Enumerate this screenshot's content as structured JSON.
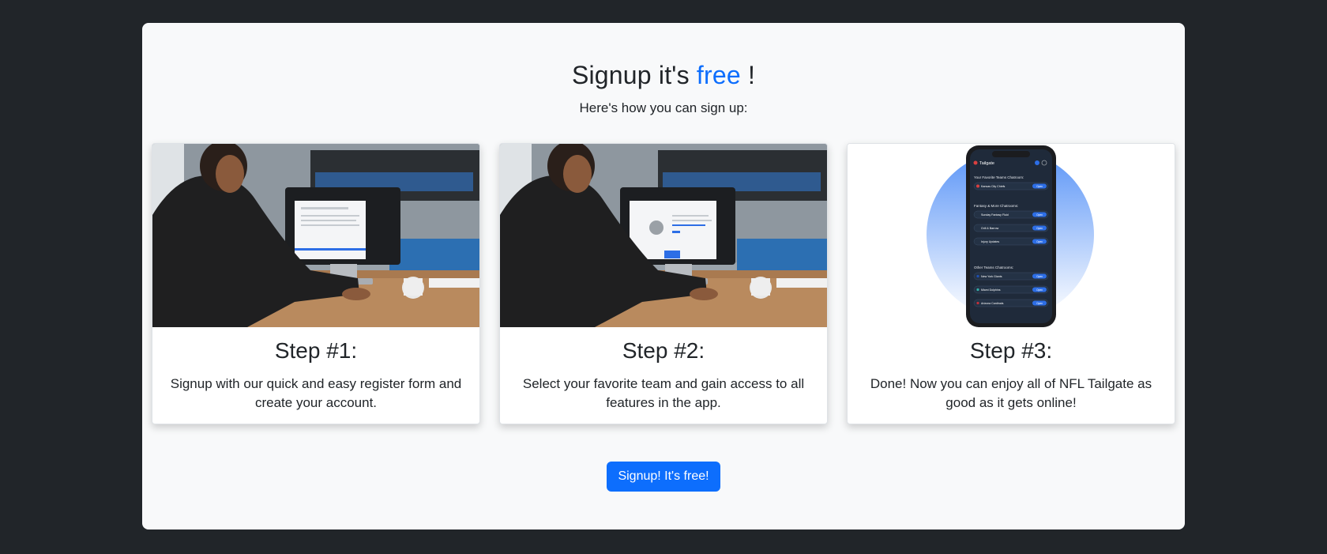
{
  "section": {
    "heading_prefix": "Signup it's",
    "heading_accent": "free",
    "heading_suffix": "!",
    "subheading": "Here's how you can sign up:"
  },
  "cards": [
    {
      "image_icon": "person-at-computer-register-form-photo",
      "title": "Step #1:",
      "text": "Signup with our quick and easy register form and create your account."
    },
    {
      "image_icon": "person-at-computer-team-selection-photo",
      "title": "Step #2:",
      "text": "Select your favorite team and gain access to all features in the app."
    },
    {
      "image_icon": "phone-app-mockup",
      "title": "Step #3:",
      "text": "Done! Now you can enjoy all of NFL Tailgate as good as it gets online!",
      "phone": {
        "app_name": "Tailgate",
        "favorites_heading": "Your Favorite Teams Chatroom:",
        "favorites": [
          {
            "label": "Kansas City Chiefs",
            "button": "Open"
          }
        ],
        "fantasy_heading": "Fantasy & More Chatrooms:",
        "fantasy": [
          {
            "label": "Sunday Fantasy Fluid",
            "button": "Open"
          },
          {
            "label": "Grill & Barrow",
            "button": "Open"
          },
          {
            "label": "Injury Updates",
            "button": "Open"
          }
        ],
        "others_heading": "Other Teams Chatrooms:",
        "others": [
          {
            "label": "New York Giants",
            "button": "Open"
          },
          {
            "label": "Miami Dolphins",
            "button": "Open"
          },
          {
            "label": "Arizona Cardinals",
            "button": "Open"
          }
        ]
      }
    }
  ],
  "cta_label": "Signup! It's free!",
  "colors": {
    "page_background": "#212529",
    "panel_background": "#f8f9fa",
    "accent": "#0d6efd"
  }
}
